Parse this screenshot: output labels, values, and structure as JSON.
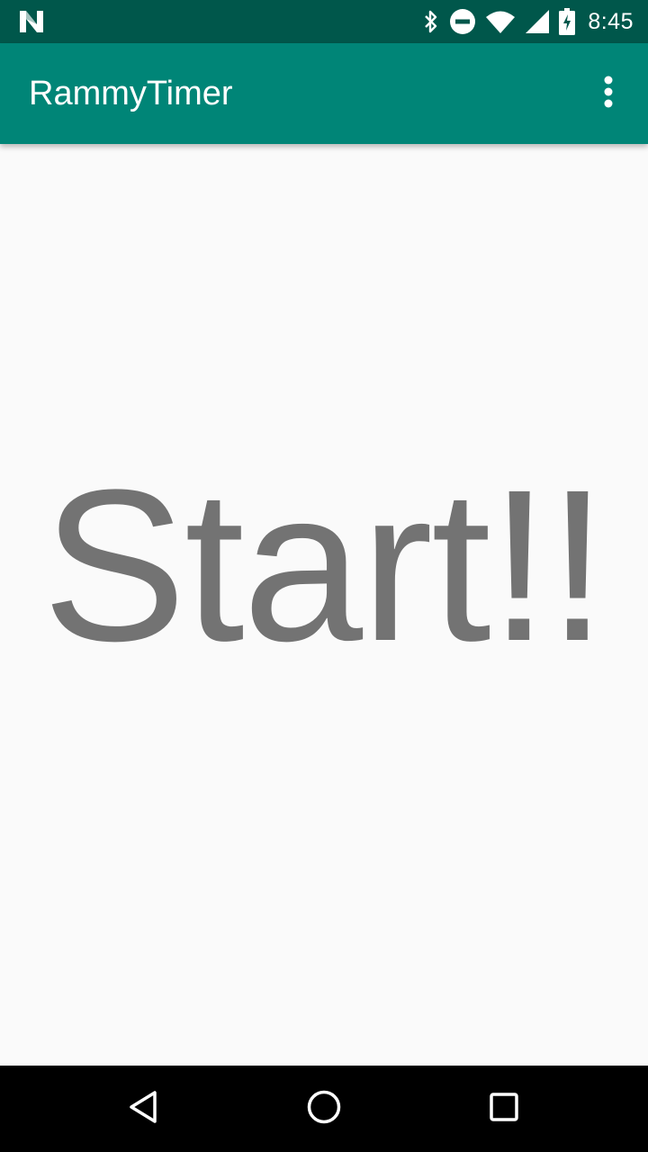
{
  "status_bar": {
    "time": "8:45",
    "icons": [
      "notification-n-icon",
      "bluetooth-icon",
      "do-not-disturb-icon",
      "wifi-icon",
      "cell-signal-icon",
      "battery-charging-icon"
    ]
  },
  "app_bar": {
    "title": "RammyTimer",
    "overflow_icon": "more-vert-icon"
  },
  "main": {
    "start_label": "Start!!"
  },
  "nav_bar": {
    "icons": [
      "back-icon",
      "home-icon",
      "recents-icon"
    ]
  },
  "colors": {
    "status_bar": "#00574b",
    "app_bar": "#008577",
    "background": "#fafafa",
    "start_text": "#737373",
    "nav_bar": "#000000"
  }
}
